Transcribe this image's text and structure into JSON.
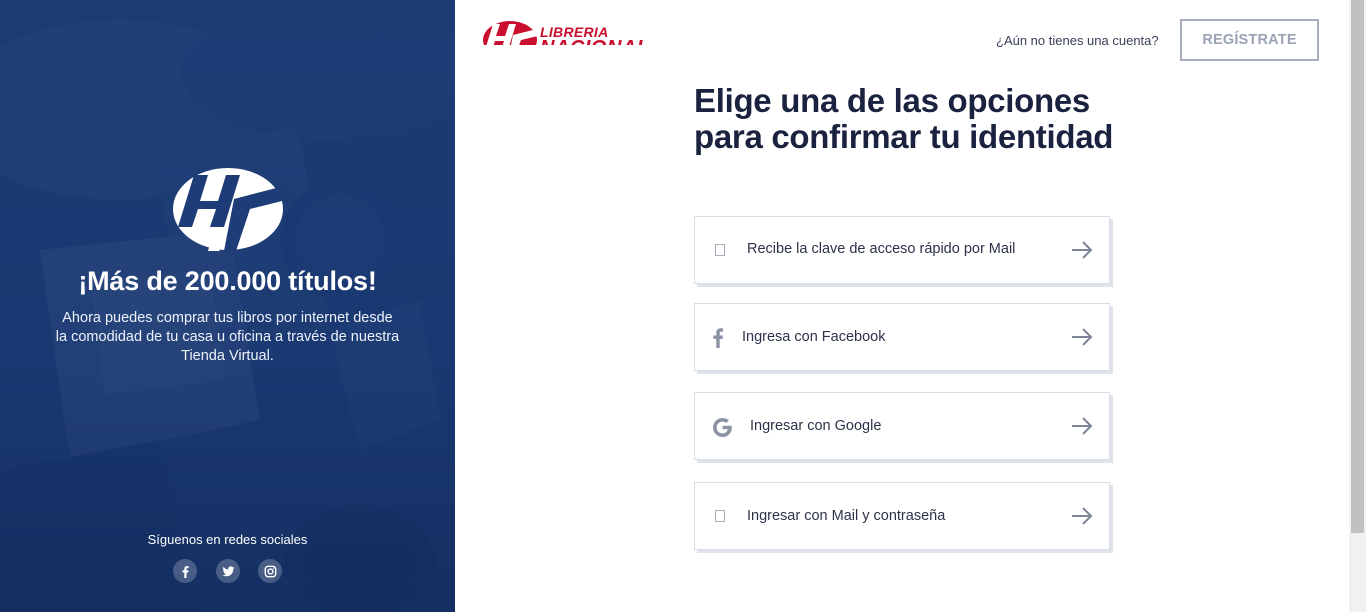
{
  "hero": {
    "title": "¡Más de 200.000 títulos!",
    "text": "Ahora puedes comprar tus libros por internet desde la comodidad de tu casa u oficina a través de nuestra Tienda Virtual.",
    "follow_label": "Síguenos en redes sociales",
    "social": [
      "facebook-icon",
      "twitter-icon",
      "instagram-icon"
    ]
  },
  "brand": {
    "line1": "LIBRERIA",
    "line2": "NACIONAL"
  },
  "header": {
    "question": "¿Aún no tienes una cuenta?",
    "register_label": "REGÍSTRATE"
  },
  "main": {
    "heading": "Elige una de las opciones para confirmar tu identidad",
    "options": [
      {
        "label": "Recibe la clave de acceso rápido por Mail",
        "icon": "mail-icon"
      },
      {
        "label": "Ingresa con Facebook",
        "icon": "facebook-icon"
      },
      {
        "label": "Ingresar con Google",
        "icon": "google-icon"
      },
      {
        "label": "Ingresar con Mail y contraseña",
        "icon": "lock-icon"
      }
    ]
  },
  "colors": {
    "brand_red": "#c8102e",
    "hero_blue": "#1b3a73",
    "heading": "#1a2240",
    "register_border": "#a6aebd"
  }
}
